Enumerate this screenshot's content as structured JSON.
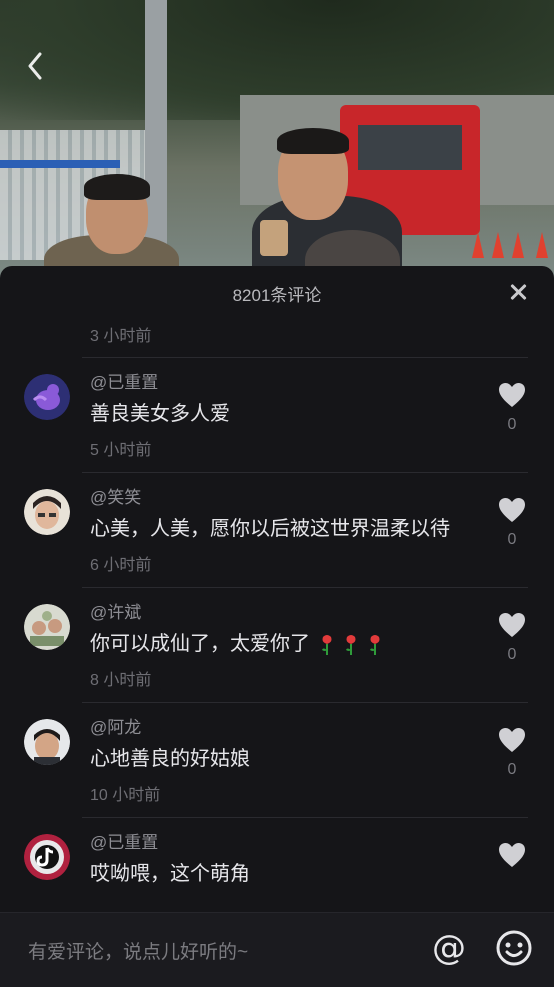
{
  "nav": {
    "back_icon": "chevron-left-icon"
  },
  "panel": {
    "title": "8201条评论",
    "close_icon": "close-icon",
    "partial_time": "3 小时前"
  },
  "comments": [
    {
      "author": "@已重置",
      "text": "善良美女多人爱",
      "time": "5 小时前",
      "likes": "0",
      "avatar_color": "#3b3d8a"
    },
    {
      "author": "@笑笑",
      "text": "心美，人美，愿你以后被这世界温柔以待",
      "time": "6 小时前",
      "likes": "0",
      "avatar_color": "#d5c0b0"
    },
    {
      "author": "@许斌",
      "text": "你可以成仙了，太爱你了",
      "time": "8 小时前",
      "likes": "0",
      "avatar_color": "#bdbfb3"
    },
    {
      "author": "@阿龙",
      "text": "心地善良的好姑娘",
      "time": "10 小时前",
      "likes": "0",
      "avatar_color": "#cda892"
    },
    {
      "author": "@已重置",
      "text": "哎呦喂，这个萌角",
      "time": "",
      "likes": "",
      "avatar_color": "#9b1f3a"
    }
  ],
  "input": {
    "placeholder": "有爱评论，说点儿好听的~",
    "at_icon": "at-icon",
    "at_label": "@",
    "emoji_icon": "smiley-icon"
  },
  "colors": {
    "panel_bg": "#151518",
    "text_primary": "#e6e6ea",
    "text_secondary": "#8e8e94",
    "text_time": "#6e6e74"
  }
}
